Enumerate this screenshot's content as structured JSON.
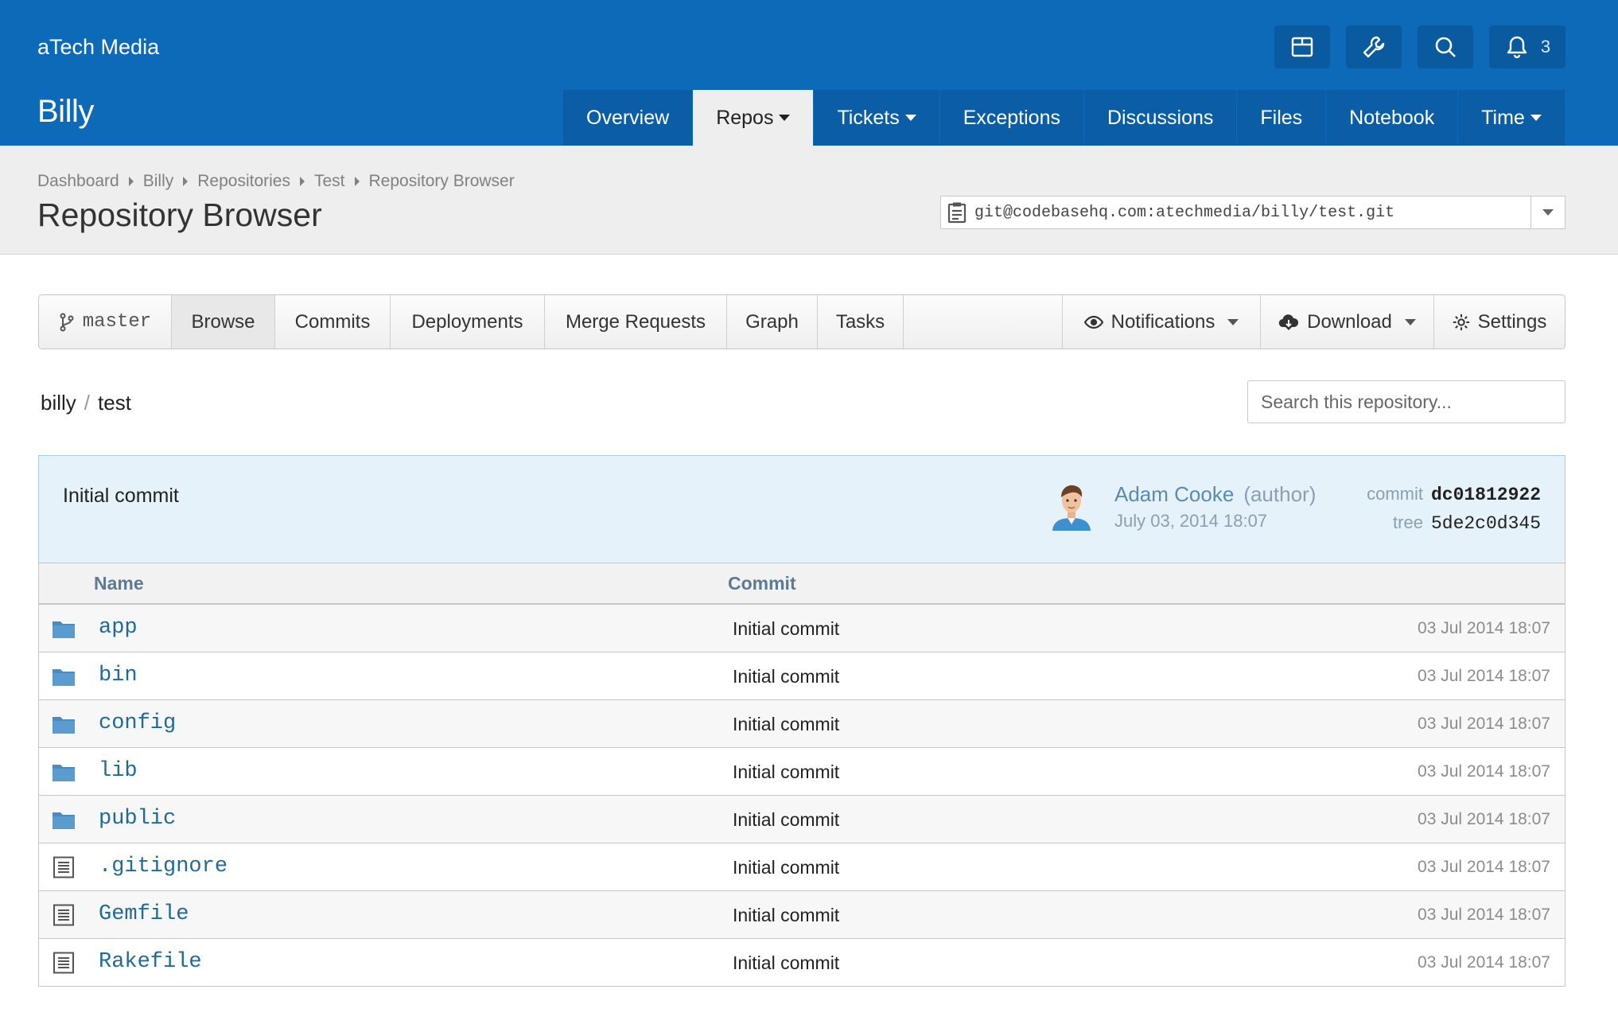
{
  "header": {
    "org": "aTech Media",
    "project": "Billy",
    "notifications_count": "3",
    "nav": [
      {
        "label": "Overview",
        "dropdown": false,
        "active": false
      },
      {
        "label": "Repos",
        "dropdown": true,
        "active": true
      },
      {
        "label": "Tickets",
        "dropdown": true,
        "active": false
      },
      {
        "label": "Exceptions",
        "dropdown": false,
        "active": false
      },
      {
        "label": "Discussions",
        "dropdown": false,
        "active": false
      },
      {
        "label": "Files",
        "dropdown": false,
        "active": false
      },
      {
        "label": "Notebook",
        "dropdown": false,
        "active": false
      },
      {
        "label": "Time",
        "dropdown": true,
        "active": false
      }
    ]
  },
  "breadcrumb": [
    "Dashboard",
    "Billy",
    "Repositories",
    "Test",
    "Repository Browser"
  ],
  "page_title": "Repository Browser",
  "clone_url": "git@codebasehq.com:atechmedia/billy/test.git",
  "toolbar": {
    "branch": "master",
    "browse": "Browse",
    "commits": "Commits",
    "deployments": "Deployments",
    "merge_requests": "Merge Requests",
    "graph": "Graph",
    "tasks": "Tasks",
    "notifications": "Notifications",
    "download": "Download",
    "settings": "Settings"
  },
  "path": {
    "repo": "billy",
    "sep": "/",
    "name": "test"
  },
  "search": {
    "placeholder": "Search this repository..."
  },
  "commit": {
    "message": "Initial commit",
    "author": "Adam Cooke",
    "role": "(author)",
    "date": "July 03, 2014 18:07",
    "commit_label": "commit",
    "commit_sha": "dc01812922",
    "tree_label": "tree",
    "tree_sha": "5de2c0d345"
  },
  "table": {
    "col_name": "Name",
    "col_commit": "Commit",
    "rows": [
      {
        "type": "folder",
        "name": "app",
        "commit": "Initial commit",
        "date": "03 Jul 2014 18:07"
      },
      {
        "type": "folder",
        "name": "bin",
        "commit": "Initial commit",
        "date": "03 Jul 2014 18:07"
      },
      {
        "type": "folder",
        "name": "config",
        "commit": "Initial commit",
        "date": "03 Jul 2014 18:07"
      },
      {
        "type": "folder",
        "name": "lib",
        "commit": "Initial commit",
        "date": "03 Jul 2014 18:07"
      },
      {
        "type": "folder",
        "name": "public",
        "commit": "Initial commit",
        "date": "03 Jul 2014 18:07"
      },
      {
        "type": "file",
        "name": ".gitignore",
        "commit": "Initial commit",
        "date": "03 Jul 2014 18:07"
      },
      {
        "type": "file",
        "name": "Gemfile",
        "commit": "Initial commit",
        "date": "03 Jul 2014 18:07"
      },
      {
        "type": "file",
        "name": "Rakefile",
        "commit": "Initial commit",
        "date": "03 Jul 2014 18:07"
      }
    ]
  },
  "colors": {
    "header_blue": "#0d6ab8",
    "link_blue": "#1f6b96",
    "folder_blue": "#4a8bc0",
    "commit_box": "#e6f2f9"
  }
}
